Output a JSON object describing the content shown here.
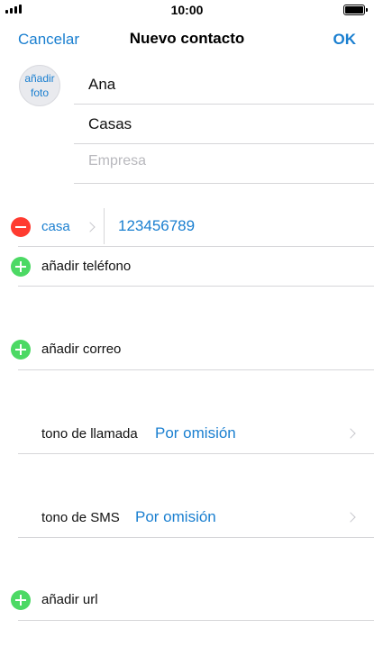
{
  "status_bar": {
    "time": "10:00",
    "battery_level": 1.0,
    "signal_bars": 4
  },
  "nav": {
    "cancel": "Cancelar",
    "title": "Nuevo contacto",
    "ok": "OK"
  },
  "photo": {
    "line1": "añadir",
    "line2": "foto"
  },
  "name_fields": {
    "first_name": "Ana",
    "last_name": "Casas",
    "company_placeholder": "Empresa"
  },
  "phone": {
    "label": "casa",
    "value": "123456789"
  },
  "actions": {
    "add_phone": "añadir teléfono",
    "add_email": "añadir correo",
    "add_url": "añadir url"
  },
  "ringtone": {
    "label": "tono de llamada",
    "value": "Por omisión"
  },
  "sms_tone": {
    "label": "tono de SMS",
    "value": "Por omisión"
  },
  "colors": {
    "accent": "#1a7fd0",
    "add": "#4cd964",
    "remove": "#ff3b30",
    "separator": "#d6d6d9"
  },
  "icons": [
    "signal-icon",
    "battery-icon",
    "add-icon",
    "remove-icon",
    "chevron-right-icon"
  ]
}
